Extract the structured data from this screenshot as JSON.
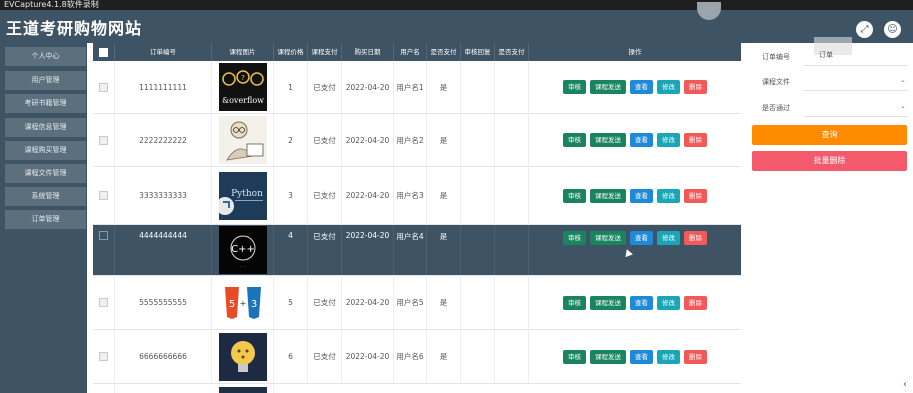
{
  "capture_bar": {
    "text": "EVCapture4.1.8软件录制"
  },
  "header": {
    "title": "王道考研购物网站",
    "icons": [
      "expand-icon",
      "user-icon"
    ]
  },
  "sidebar": {
    "items": [
      {
        "label": "个人中心"
      },
      {
        "label": "用户管理"
      },
      {
        "label": "考研书籍管理"
      },
      {
        "label": "课程信息管理"
      },
      {
        "label": "课程购买管理"
      },
      {
        "label": "课程文件管理"
      },
      {
        "label": "系统管理"
      },
      {
        "label": "订单管理"
      }
    ]
  },
  "table": {
    "headers": [
      "",
      "订单编号",
      "课程图片",
      "课程价格",
      "课程支付",
      "购买日期",
      "用户名",
      "是否支付",
      "审核回复",
      "是否支付",
      "操作"
    ],
    "actions": [
      "审核",
      "课程发送",
      "查看",
      "修改",
      "删除"
    ],
    "rows": [
      {
        "order_no": "1111111111",
        "price": "1",
        "pay": "已支付",
        "date": "2022-04-20",
        "user": "用户名1",
        "paid": "是",
        "image": "overflow-image"
      },
      {
        "order_no": "2222222222",
        "price": "2",
        "pay": "已支付",
        "date": "2022-04-20",
        "user": "用户名2",
        "paid": "是",
        "image": "sketch-person-image"
      },
      {
        "order_no": "3333333333",
        "price": "3",
        "pay": "已支付",
        "date": "2022-04-20",
        "user": "用户名3",
        "paid": "是",
        "image": "python-image"
      },
      {
        "order_no": "4444444444",
        "price": "4",
        "pay": "已支付",
        "date": "2022-04-20",
        "user": "用户名4",
        "paid": "是",
        "image": "cpp-image"
      },
      {
        "order_no": "5555555555",
        "price": "5",
        "pay": "已支付",
        "date": "2022-04-20",
        "user": "用户名5",
        "paid": "是",
        "image": "html5-css3-image"
      },
      {
        "order_no": "6666666666",
        "price": "6",
        "pay": "已支付",
        "date": "2022-04-20",
        "user": "用户名6",
        "paid": "是",
        "image": "lightbulb-image"
      }
    ]
  },
  "filter": {
    "order_no_label": "订单编号",
    "order_no_value": "订单",
    "course_file_label": "课程文件",
    "approved_label": "是否通过",
    "query_button": "查询",
    "batch_delete_button": "批量删除"
  },
  "colors": {
    "header_bg": "#3e5363",
    "green": "#19845f",
    "blue": "#1e8ad9",
    "cyan": "#1aa6b7",
    "red": "#f25a59",
    "orange": "#ff8b00",
    "pink": "#f35a6c"
  }
}
